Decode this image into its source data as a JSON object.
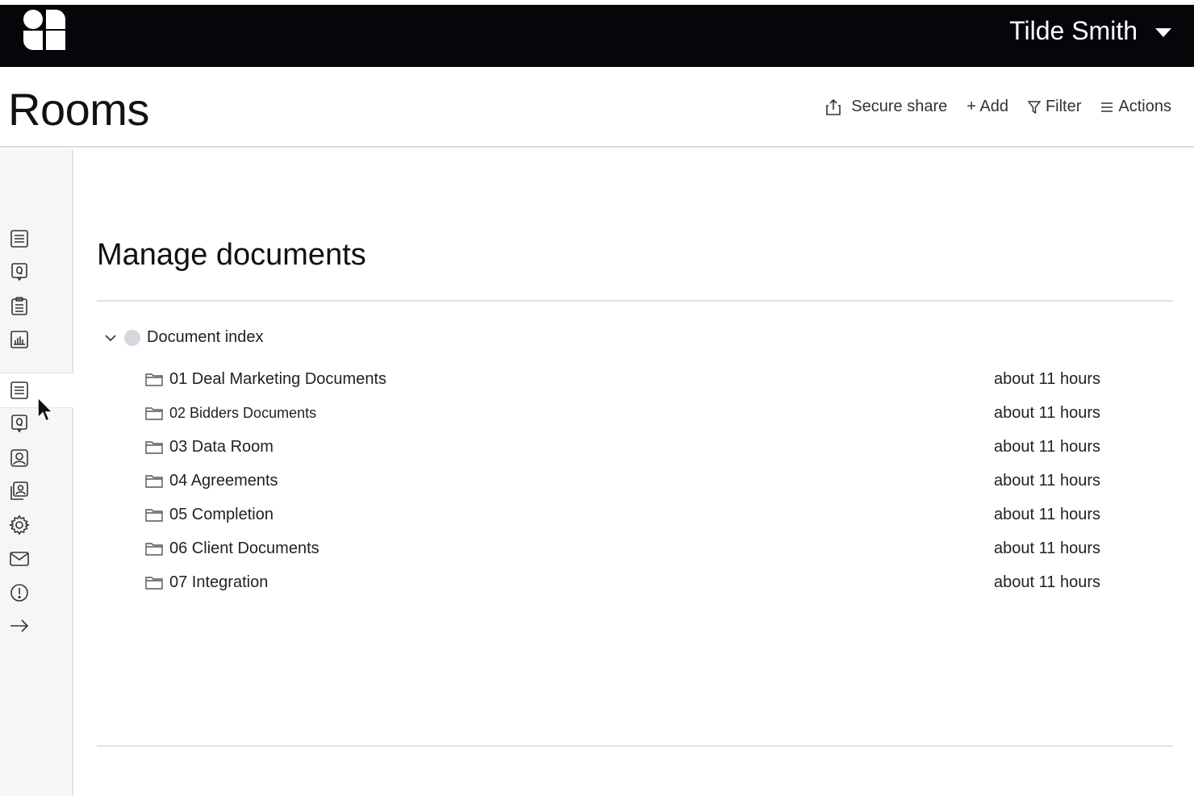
{
  "topbar": {
    "logo_icon": "brand-logo-icon",
    "user_name": "Tilde Smith"
  },
  "header": {
    "title": "Rooms",
    "toolbar": {
      "secure_share": "Secure share",
      "add": "+ Add",
      "filter": "Filter",
      "actions": "Actions"
    }
  },
  "sidebar": {
    "items": [
      {
        "icon": "list-icon"
      },
      {
        "icon": "question-icon"
      },
      {
        "icon": "clipboard-icon"
      },
      {
        "icon": "chart-icon"
      },
      {
        "icon": "list-icon",
        "active": true
      },
      {
        "icon": "question-icon"
      },
      {
        "icon": "contact-icon"
      },
      {
        "icon": "contacts-icon"
      },
      {
        "icon": "gear-icon"
      },
      {
        "icon": "mail-icon"
      },
      {
        "icon": "alert-icon"
      },
      {
        "icon": "arrow-right-icon"
      }
    ]
  },
  "main": {
    "section_title": "Manage documents",
    "index": {
      "label": "Document index",
      "folders": [
        {
          "name": "01 Deal Marketing Documents",
          "time": "about 11 hours"
        },
        {
          "name": "02 Bidders Documents",
          "time": "about 11 hours"
        },
        {
          "name": "03 Data Room",
          "time": "about 11 hours"
        },
        {
          "name": "04 Agreements",
          "time": "about 11 hours"
        },
        {
          "name": "05 Completion",
          "time": "about 11 hours"
        },
        {
          "name": "06 Client Documents",
          "time": "about 11 hours"
        },
        {
          "name": "07 Integration",
          "time": "about 11 hours"
        }
      ]
    }
  },
  "colors": {
    "topbar_bg": "#05060a",
    "sidebar_bg": "#f6f6f6",
    "index_dot": "#d4d8dc"
  }
}
